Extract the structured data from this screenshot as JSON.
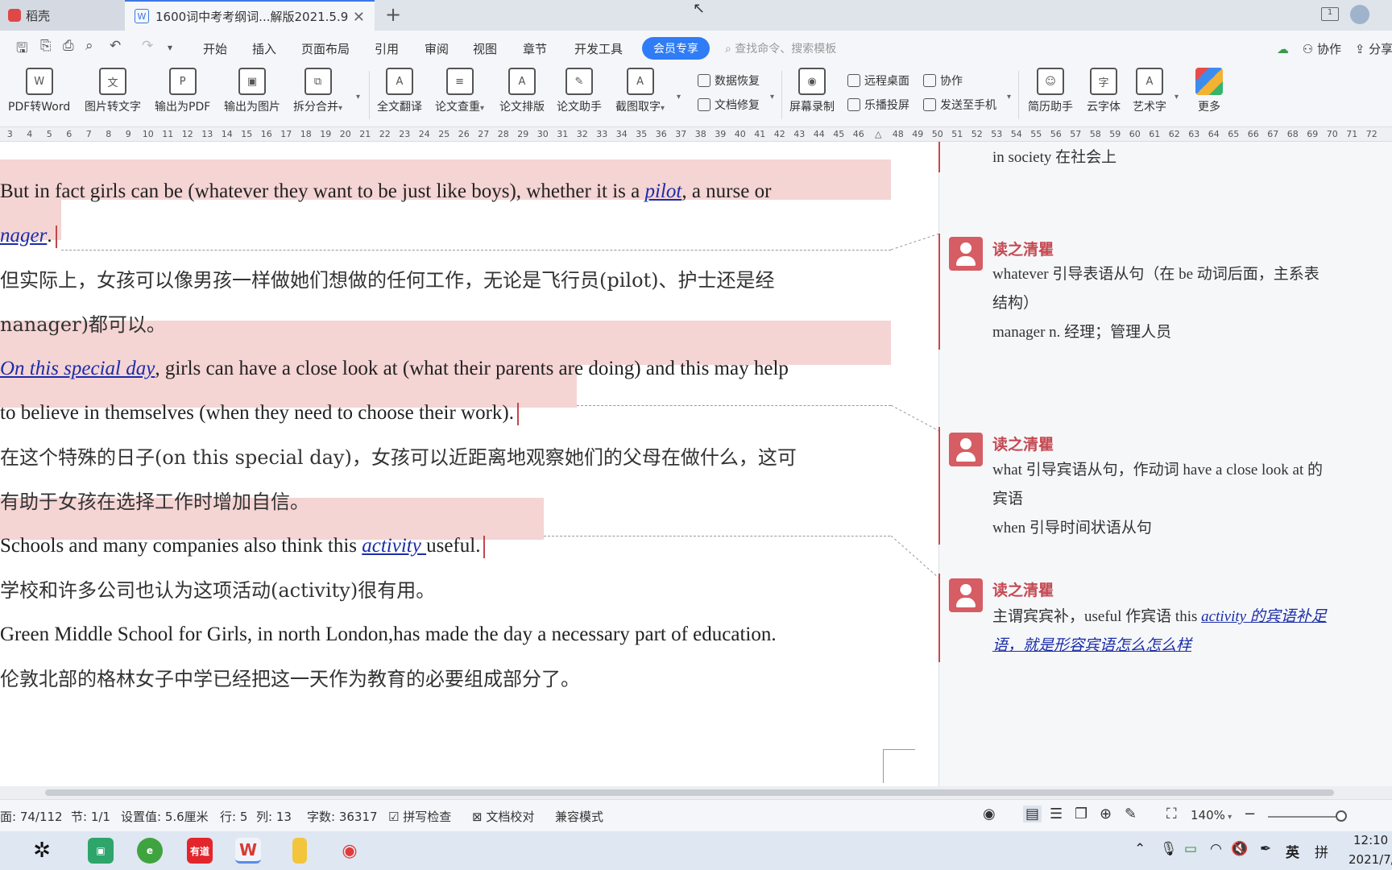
{
  "tabs": [
    {
      "label": "稻壳"
    },
    {
      "label": "1600词中考考纲词...解版2021.5.9"
    }
  ],
  "menu": {
    "items": [
      "开始",
      "插入",
      "页面布局",
      "引用",
      "审阅",
      "视图",
      "章节",
      "开发工具"
    ],
    "vip": "会员专享",
    "search_placeholder": "查找命令、搜索模板",
    "collab": "协作",
    "share": "分享"
  },
  "ribbon": {
    "buttons": [
      "PDF转Word",
      "图片转文字",
      "输出为PDF",
      "输出为图片",
      "拆分合并",
      "全文翻译",
      "论文查重",
      "论文排版",
      "论文助手",
      "截图取字",
      "屏幕录制",
      "简历助手",
      "云字体",
      "艺术字",
      "更多"
    ],
    "small": [
      "数据恢复",
      "文档修复",
      "远程桌面",
      "协作",
      "乐播投屏",
      "发送至手机"
    ]
  },
  "ruler": [
    "3",
    "4",
    "5",
    "6",
    "7",
    "8",
    "9",
    "10",
    "11",
    "12",
    "13",
    "14",
    "15",
    "16",
    "17",
    "18",
    "19",
    "20",
    "21",
    "22",
    "23",
    "24",
    "25",
    "26",
    "27",
    "28",
    "29",
    "30",
    "31",
    "32",
    "33",
    "34",
    "35",
    "36",
    "37",
    "38",
    "39",
    "40",
    "41",
    "42",
    "43",
    "44",
    "45",
    "46",
    "",
    "48",
    "49",
    "50",
    "51",
    "52",
    "53",
    "54",
    "55",
    "56",
    "57",
    "58",
    "59",
    "60",
    "61",
    "62",
    "63",
    "64",
    "65",
    "66",
    "67",
    "68",
    "69",
    "70",
    "71",
    "72"
  ],
  "doc": {
    "p1_a": "But in fact girls can be (whatever they want to be just like boys), whether it is a ",
    "p1_link": "pilot",
    "p1_b": ", a nurse or",
    "p2_link": "nager",
    "p2_b": ".",
    "p3": "但实际上，女孩可以像男孩一样做她们想做的任何工作，无论是飞行员(pilot)、护士还是经",
    "p4": "nanager)都可以。",
    "p5_link": "On this special day",
    "p5_b": ", girls can have a close look at (what their parents are doing) and this may help",
    "p6": "to believe in themselves (when they need to choose their work).",
    "p7": "在这个特殊的日子(on this special day)，女孩可以近距离地观察她们的父母在做什么，这可",
    "p8": "有助于女孩在选择工作时增加自信。",
    "p9_a": "Schools and many companies also think this ",
    "p9_link": "activity ",
    "p9_b": "useful.",
    "p10": "学校和许多公司也认为这项活动(activity)很有用。",
    "p11": "Green Middle School for Girls, in north London,has made the day a necessary part of education.",
    "p12": "伦敦北部的格林女子中学已经把这一天作为教育的必要组成部分了。"
  },
  "comments": {
    "top_text": "in society  在社会上",
    "c1": {
      "author": "读之清瞿",
      "line1": "whatever  引导表语从句（在 be 动词后面，主系表",
      "line2": "结构）",
      "line3": "manager n. 经理；管理人员"
    },
    "c2": {
      "author": "读之清瞿",
      "line1": "what 引导宾语从句，作动词 have a close look at 的",
      "line2": "宾语",
      "line3": "when 引导时间状语从句"
    },
    "c3": {
      "author": "读之清瞿",
      "line1_a": "主谓宾宾补，useful 作宾语 this ",
      "line1_link": "activity 的宾语补足",
      "line2_link": "语，就是形容宾语怎么怎么样"
    }
  },
  "status": {
    "page": "面: 74/112",
    "section": "节: 1/1",
    "setting": "设置值: 5.6厘米",
    "row": "行: 5",
    "col": "列: 13",
    "words": "字数: 36317",
    "spell": "拼写检查",
    "proof": "文档校对",
    "compat": "兼容模式",
    "zoom": "140%"
  },
  "taskbar": {
    "youdao": "有道",
    "ime1": "英",
    "ime2": "拼",
    "time": "12:10",
    "date": "2021/7/"
  }
}
